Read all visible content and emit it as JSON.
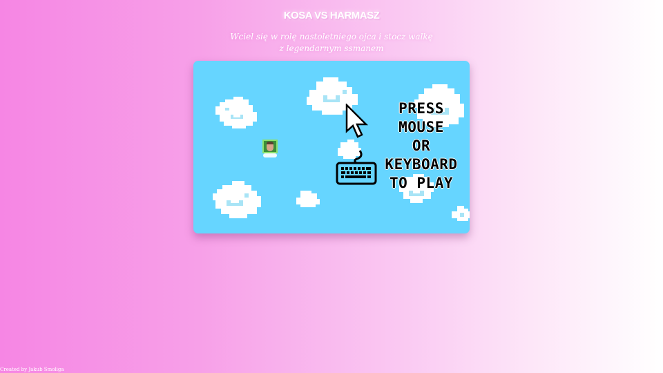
{
  "header": {
    "title": "KOSA VS HARMASZ",
    "subtitle": "Wciel się w rolę nastoletniego ojca i stocz walkę z legendarnym ssmanem"
  },
  "game": {
    "background_color": "#66d5ff",
    "prompt_lines": [
      "PRESS",
      "MOUSE",
      "OR",
      "KEYBOARD",
      "TO PLAY"
    ],
    "icons": [
      "mouse-cursor-icon",
      "keyboard-icon"
    ]
  },
  "footer": {
    "credit": "Created by Jakub Smoliga"
  }
}
